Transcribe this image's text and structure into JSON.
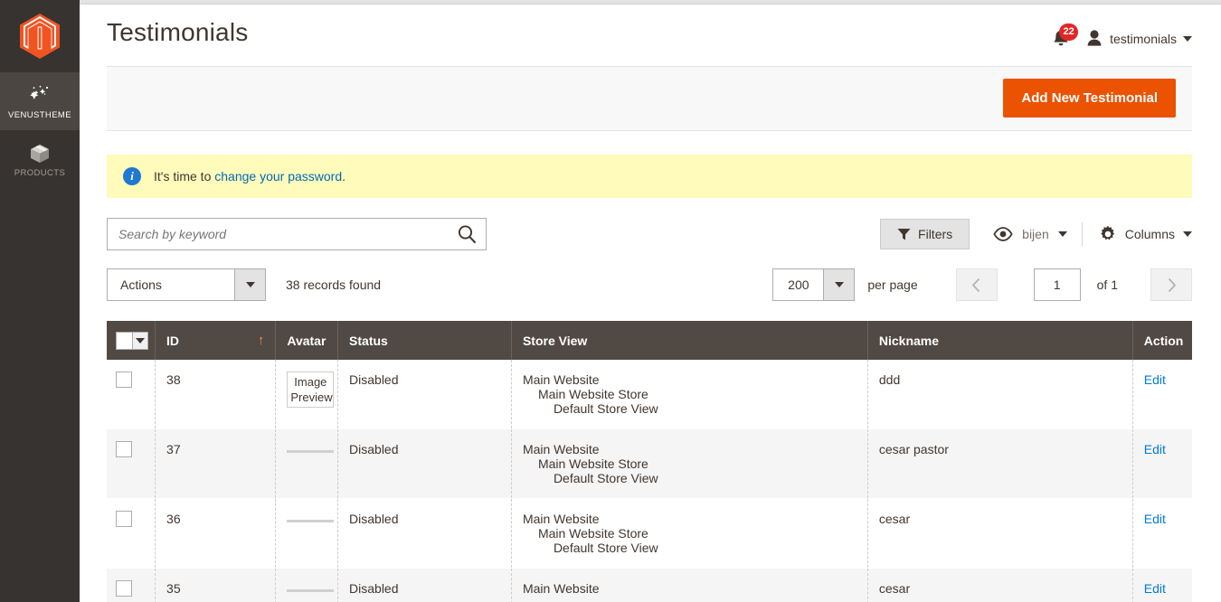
{
  "sidebar": {
    "logo_name": "magento-logo",
    "items": [
      {
        "label": "VENUSTHEME",
        "icon": "sparkles-icon",
        "active": true
      },
      {
        "label": "PRODUCTS",
        "icon": "box-icon",
        "active": false
      }
    ]
  },
  "header": {
    "title": "Testimonials",
    "notifications_count": "22",
    "user_name": "testimonials"
  },
  "action_bar": {
    "add_button": "Add New Testimonial"
  },
  "message": {
    "prefix": "It's time to ",
    "link": "change your password",
    "suffix": "."
  },
  "toolbar": {
    "search_placeholder": "Search by keyword",
    "search_value": "",
    "filters_label": "Filters",
    "view_label": "bijen",
    "columns_label": "Columns"
  },
  "actions_row": {
    "actions_label": "Actions",
    "records_found": "38 records found",
    "per_page_value": "200",
    "per_page_label": "per page",
    "page_value": "1",
    "page_of": "of 1"
  },
  "table": {
    "columns": [
      "ID",
      "Avatar",
      "Status",
      "Store View",
      "Nickname",
      "Action"
    ],
    "sort_column": "ID",
    "sort_direction": "asc",
    "rows": [
      {
        "id": "38",
        "avatar": "Image Preview",
        "avatar_type": "preview",
        "status": "Disabled",
        "store_l1": "Main Website",
        "store_l2": "Main Website Store",
        "store_l3": "Default Store View",
        "nickname": "ddd",
        "action": "Edit"
      },
      {
        "id": "37",
        "avatar": "",
        "avatar_type": "broken",
        "status": "Disabled",
        "store_l1": "Main Website",
        "store_l2": "Main Website Store",
        "store_l3": "Default Store View",
        "nickname": "cesar pastor",
        "action": "Edit"
      },
      {
        "id": "36",
        "avatar": "",
        "avatar_type": "broken",
        "status": "Disabled",
        "store_l1": "Main Website",
        "store_l2": "Main Website Store",
        "store_l3": "Default Store View",
        "nickname": "cesar",
        "action": "Edit"
      },
      {
        "id": "35",
        "avatar": "",
        "avatar_type": "broken",
        "status": "Disabled",
        "store_l1": "Main Website",
        "store_l2": "",
        "store_l3": "",
        "nickname": "cesar",
        "action": "Edit"
      }
    ]
  },
  "colors": {
    "accent_orange": "#eb5202",
    "sidebar_bg": "#373330",
    "table_header_bg": "#514943",
    "link_blue": "#007bdb",
    "message_bg": "#fffbbb",
    "badge_red": "#e22626"
  }
}
